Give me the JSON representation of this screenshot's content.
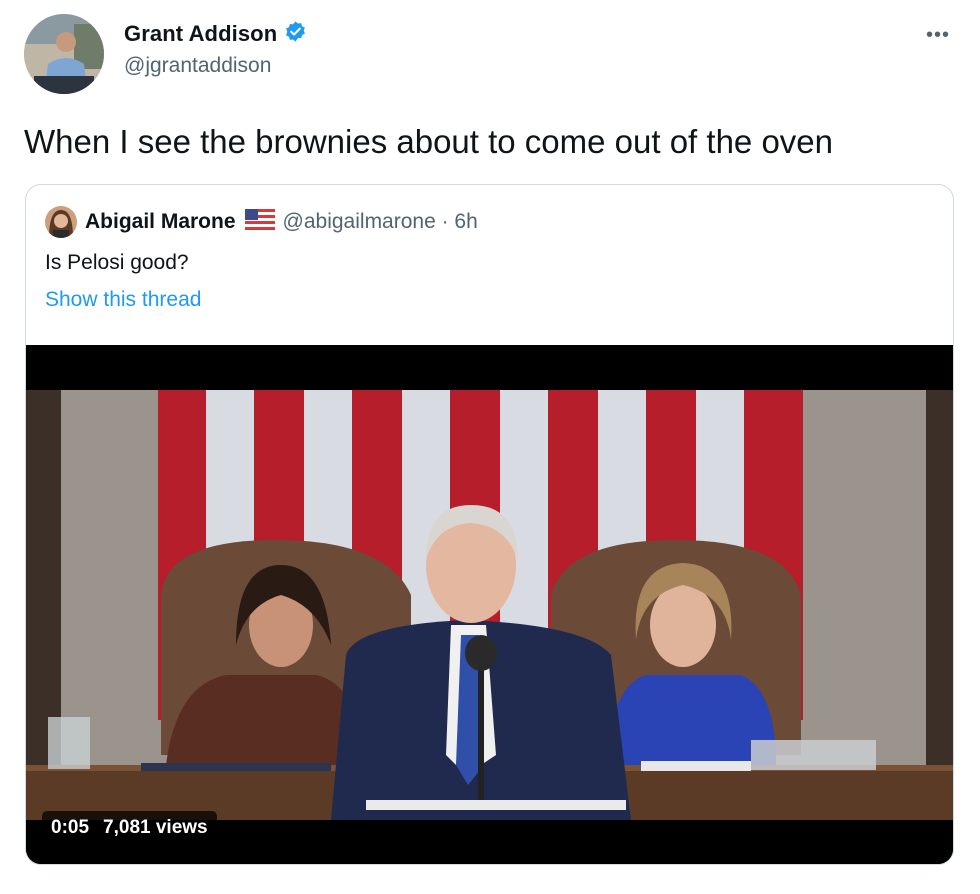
{
  "author": {
    "name": "Grant Addison",
    "handle": "@jgrantaddison",
    "verified": true,
    "avatar_icon": "profile-photo"
  },
  "more_label": "•••",
  "tweet": {
    "text": "When I see the brownies about to come out of the oven"
  },
  "quoted": {
    "name": "Abigail Marone",
    "flag_icon": "us-flag-icon",
    "meta": "@abigailmarone · 6h",
    "text": "Is Pelosi good?",
    "show_thread": "Show this thread"
  },
  "video": {
    "time": "0:05",
    "views": "7,081 views"
  },
  "colors": {
    "accent": "#1d9bf0",
    "text": "#0f1419",
    "secondary": "#536471",
    "border": "#cfd9de"
  }
}
